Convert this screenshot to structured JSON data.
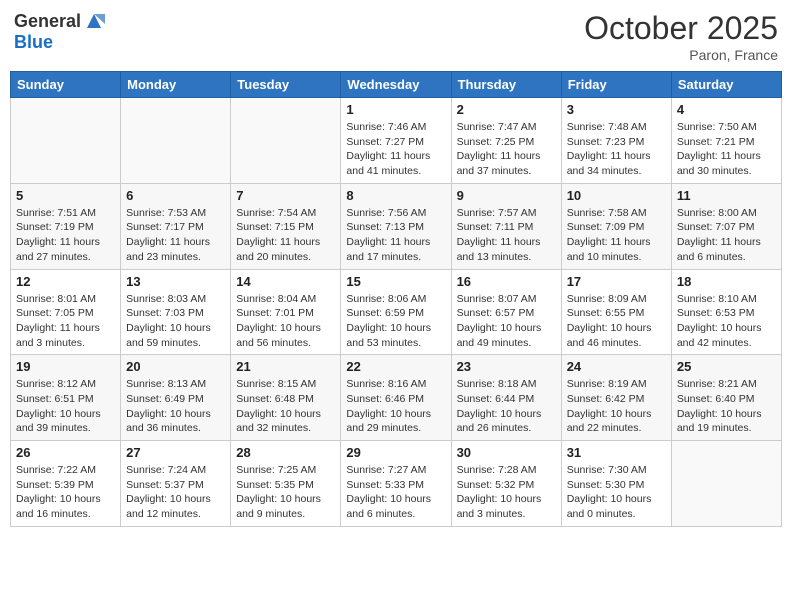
{
  "header": {
    "logo_general": "General",
    "logo_blue": "Blue",
    "month_title": "October 2025",
    "location": "Paron, France"
  },
  "weekdays": [
    "Sunday",
    "Monday",
    "Tuesday",
    "Wednesday",
    "Thursday",
    "Friday",
    "Saturday"
  ],
  "weeks": [
    [
      {
        "day": "",
        "sunrise": "",
        "sunset": "",
        "daylight": ""
      },
      {
        "day": "",
        "sunrise": "",
        "sunset": "",
        "daylight": ""
      },
      {
        "day": "",
        "sunrise": "",
        "sunset": "",
        "daylight": ""
      },
      {
        "day": "1",
        "sunrise": "Sunrise: 7:46 AM",
        "sunset": "Sunset: 7:27 PM",
        "daylight": "Daylight: 11 hours and 41 minutes."
      },
      {
        "day": "2",
        "sunrise": "Sunrise: 7:47 AM",
        "sunset": "Sunset: 7:25 PM",
        "daylight": "Daylight: 11 hours and 37 minutes."
      },
      {
        "day": "3",
        "sunrise": "Sunrise: 7:48 AM",
        "sunset": "Sunset: 7:23 PM",
        "daylight": "Daylight: 11 hours and 34 minutes."
      },
      {
        "day": "4",
        "sunrise": "Sunrise: 7:50 AM",
        "sunset": "Sunset: 7:21 PM",
        "daylight": "Daylight: 11 hours and 30 minutes."
      }
    ],
    [
      {
        "day": "5",
        "sunrise": "Sunrise: 7:51 AM",
        "sunset": "Sunset: 7:19 PM",
        "daylight": "Daylight: 11 hours and 27 minutes."
      },
      {
        "day": "6",
        "sunrise": "Sunrise: 7:53 AM",
        "sunset": "Sunset: 7:17 PM",
        "daylight": "Daylight: 11 hours and 23 minutes."
      },
      {
        "day": "7",
        "sunrise": "Sunrise: 7:54 AM",
        "sunset": "Sunset: 7:15 PM",
        "daylight": "Daylight: 11 hours and 20 minutes."
      },
      {
        "day": "8",
        "sunrise": "Sunrise: 7:56 AM",
        "sunset": "Sunset: 7:13 PM",
        "daylight": "Daylight: 11 hours and 17 minutes."
      },
      {
        "day": "9",
        "sunrise": "Sunrise: 7:57 AM",
        "sunset": "Sunset: 7:11 PM",
        "daylight": "Daylight: 11 hours and 13 minutes."
      },
      {
        "day": "10",
        "sunrise": "Sunrise: 7:58 AM",
        "sunset": "Sunset: 7:09 PM",
        "daylight": "Daylight: 11 hours and 10 minutes."
      },
      {
        "day": "11",
        "sunrise": "Sunrise: 8:00 AM",
        "sunset": "Sunset: 7:07 PM",
        "daylight": "Daylight: 11 hours and 6 minutes."
      }
    ],
    [
      {
        "day": "12",
        "sunrise": "Sunrise: 8:01 AM",
        "sunset": "Sunset: 7:05 PM",
        "daylight": "Daylight: 11 hours and 3 minutes."
      },
      {
        "day": "13",
        "sunrise": "Sunrise: 8:03 AM",
        "sunset": "Sunset: 7:03 PM",
        "daylight": "Daylight: 10 hours and 59 minutes."
      },
      {
        "day": "14",
        "sunrise": "Sunrise: 8:04 AM",
        "sunset": "Sunset: 7:01 PM",
        "daylight": "Daylight: 10 hours and 56 minutes."
      },
      {
        "day": "15",
        "sunrise": "Sunrise: 8:06 AM",
        "sunset": "Sunset: 6:59 PM",
        "daylight": "Daylight: 10 hours and 53 minutes."
      },
      {
        "day": "16",
        "sunrise": "Sunrise: 8:07 AM",
        "sunset": "Sunset: 6:57 PM",
        "daylight": "Daylight: 10 hours and 49 minutes."
      },
      {
        "day": "17",
        "sunrise": "Sunrise: 8:09 AM",
        "sunset": "Sunset: 6:55 PM",
        "daylight": "Daylight: 10 hours and 46 minutes."
      },
      {
        "day": "18",
        "sunrise": "Sunrise: 8:10 AM",
        "sunset": "Sunset: 6:53 PM",
        "daylight": "Daylight: 10 hours and 42 minutes."
      }
    ],
    [
      {
        "day": "19",
        "sunrise": "Sunrise: 8:12 AM",
        "sunset": "Sunset: 6:51 PM",
        "daylight": "Daylight: 10 hours and 39 minutes."
      },
      {
        "day": "20",
        "sunrise": "Sunrise: 8:13 AM",
        "sunset": "Sunset: 6:49 PM",
        "daylight": "Daylight: 10 hours and 36 minutes."
      },
      {
        "day": "21",
        "sunrise": "Sunrise: 8:15 AM",
        "sunset": "Sunset: 6:48 PM",
        "daylight": "Daylight: 10 hours and 32 minutes."
      },
      {
        "day": "22",
        "sunrise": "Sunrise: 8:16 AM",
        "sunset": "Sunset: 6:46 PM",
        "daylight": "Daylight: 10 hours and 29 minutes."
      },
      {
        "day": "23",
        "sunrise": "Sunrise: 8:18 AM",
        "sunset": "Sunset: 6:44 PM",
        "daylight": "Daylight: 10 hours and 26 minutes."
      },
      {
        "day": "24",
        "sunrise": "Sunrise: 8:19 AM",
        "sunset": "Sunset: 6:42 PM",
        "daylight": "Daylight: 10 hours and 22 minutes."
      },
      {
        "day": "25",
        "sunrise": "Sunrise: 8:21 AM",
        "sunset": "Sunset: 6:40 PM",
        "daylight": "Daylight: 10 hours and 19 minutes."
      }
    ],
    [
      {
        "day": "26",
        "sunrise": "Sunrise: 7:22 AM",
        "sunset": "Sunset: 5:39 PM",
        "daylight": "Daylight: 10 hours and 16 minutes."
      },
      {
        "day": "27",
        "sunrise": "Sunrise: 7:24 AM",
        "sunset": "Sunset: 5:37 PM",
        "daylight": "Daylight: 10 hours and 12 minutes."
      },
      {
        "day": "28",
        "sunrise": "Sunrise: 7:25 AM",
        "sunset": "Sunset: 5:35 PM",
        "daylight": "Daylight: 10 hours and 9 minutes."
      },
      {
        "day": "29",
        "sunrise": "Sunrise: 7:27 AM",
        "sunset": "Sunset: 5:33 PM",
        "daylight": "Daylight: 10 hours and 6 minutes."
      },
      {
        "day": "30",
        "sunrise": "Sunrise: 7:28 AM",
        "sunset": "Sunset: 5:32 PM",
        "daylight": "Daylight: 10 hours and 3 minutes."
      },
      {
        "day": "31",
        "sunrise": "Sunrise: 7:30 AM",
        "sunset": "Sunset: 5:30 PM",
        "daylight": "Daylight: 10 hours and 0 minutes."
      },
      {
        "day": "",
        "sunrise": "",
        "sunset": "",
        "daylight": ""
      }
    ]
  ]
}
